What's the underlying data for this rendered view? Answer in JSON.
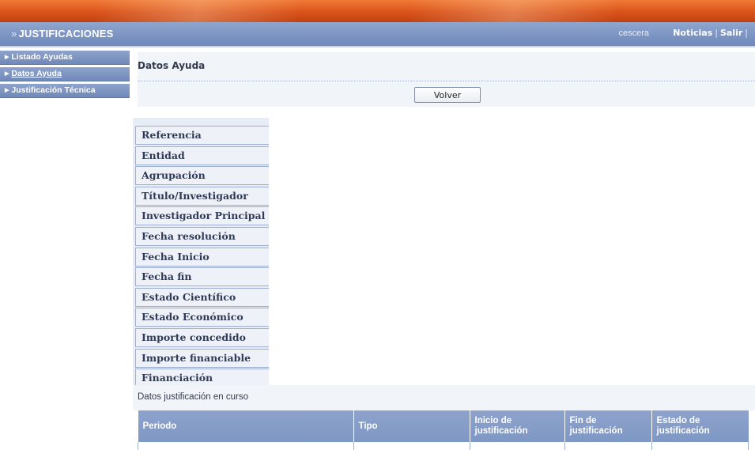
{
  "header": {
    "app_title": "JUSTIFICACIONES",
    "chevron": "»",
    "user": "cescera",
    "links": {
      "news": "Noticias",
      "logout": "Salir"
    }
  },
  "sidebar": {
    "items": [
      {
        "label": "Listado Ayudas",
        "active": false
      },
      {
        "label": "Datos Ayuda",
        "active": true
      },
      {
        "label": "Justificación Técnica",
        "active": false
      }
    ]
  },
  "main": {
    "section_title": "Datos Ayuda",
    "back_button": "Volver",
    "fields": [
      "Referencia",
      "Entidad",
      "Agrupación",
      "Título/Investigador",
      "Investigador Principal",
      "Fecha resolución",
      "Fecha Inicio",
      "Fecha fin",
      "Estado Científico",
      "Estado Económico",
      "Importe concedido",
      "Importe financiable",
      "Financiación"
    ],
    "justification": {
      "title": "Datos justificación en curso",
      "columns": [
        "Periodo",
        "Tipo",
        "Inicio de justificación",
        "Fin de justificación",
        "Estado de justificación"
      ]
    }
  },
  "colors": {
    "banner_orange": "#d9521a",
    "header_blue": "#7189b9",
    "panel_light": "#f1f4f9"
  }
}
